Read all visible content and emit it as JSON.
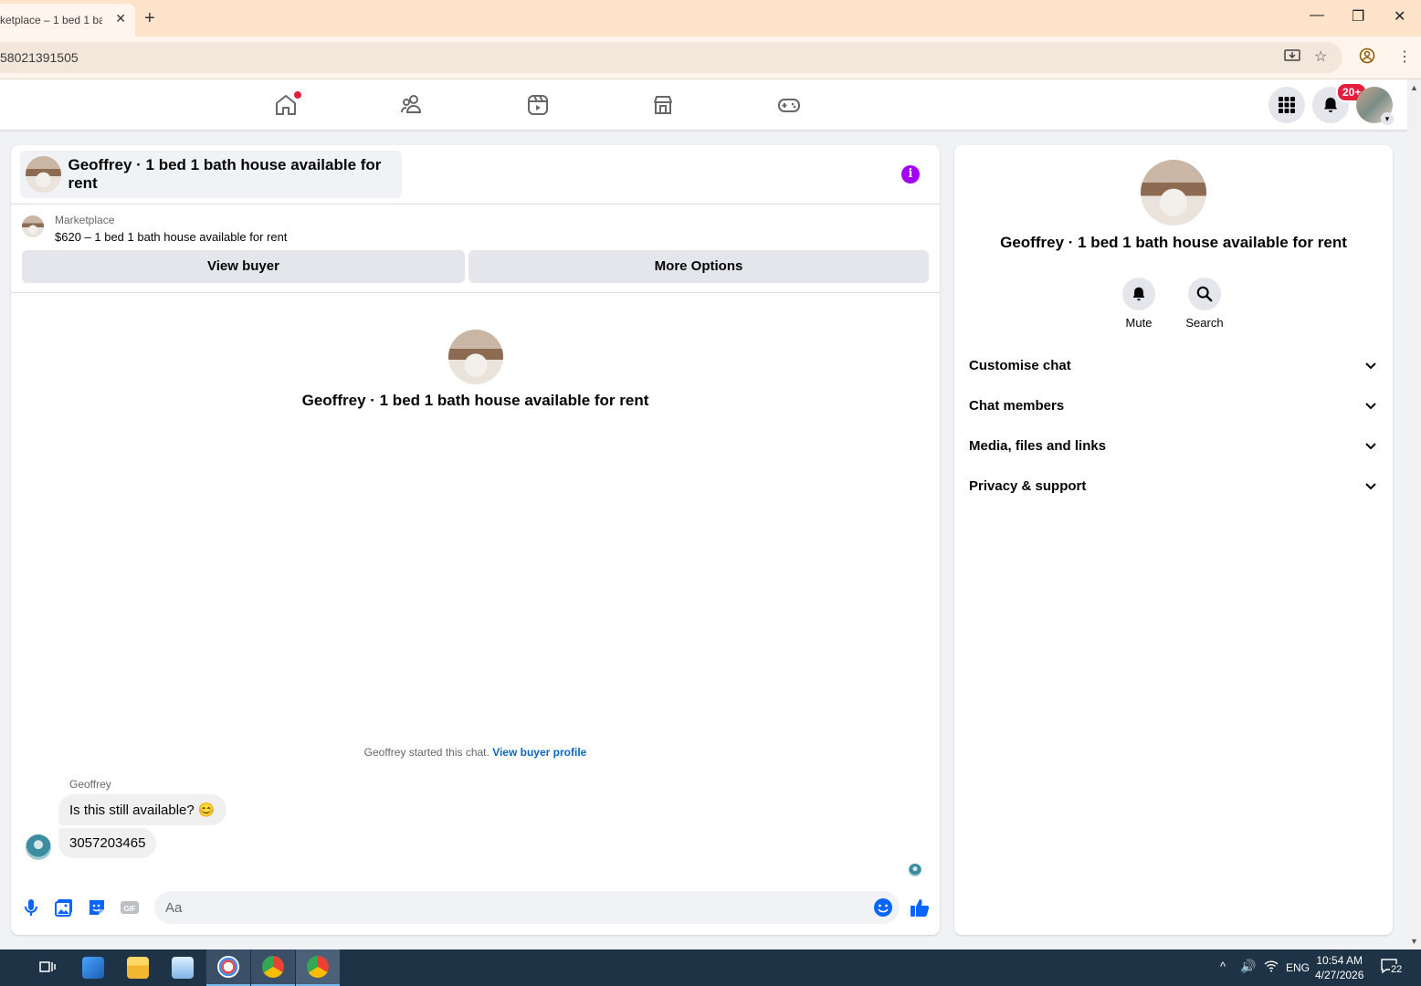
{
  "browser": {
    "tab_title": "ketplace – 1 bed 1 ba",
    "address": "58021391505"
  },
  "nav": {
    "notif_badge": "20+"
  },
  "chat": {
    "header_title": "Geoffrey · 1 bed 1 bath house available for rent",
    "marketplace_label": "Marketplace",
    "listing": "$620 – 1 bed 1 bath house available for rent",
    "view_buyer": "View buyer",
    "more_options": "More Options",
    "center_title": "Geoffrey · 1 bed 1 bath house available for rent",
    "started_text": "Geoffrey started this chat.",
    "view_buyer_profile": "View buyer profile",
    "sender_name": "Geoffrey",
    "messages": [
      {
        "text": "Is this still available? 😊"
      },
      {
        "text": "3057203465"
      }
    ],
    "input_placeholder": "Aa"
  },
  "right_panel": {
    "title": "Geoffrey · 1 bed 1 bath house available for rent",
    "mute": "Mute",
    "search": "Search",
    "sections": [
      {
        "label": "Customise chat"
      },
      {
        "label": "Chat members"
      },
      {
        "label": "Media, files and links"
      },
      {
        "label": "Privacy & support"
      }
    ]
  },
  "taskbar": {
    "lang": "ENG",
    "time": "10:54 AM",
    "date": "4/27/2026",
    "notif_count": "22"
  },
  "colors": {
    "accent": "#0866ff",
    "info": "#a100ff",
    "badge": "#e41e3f"
  }
}
